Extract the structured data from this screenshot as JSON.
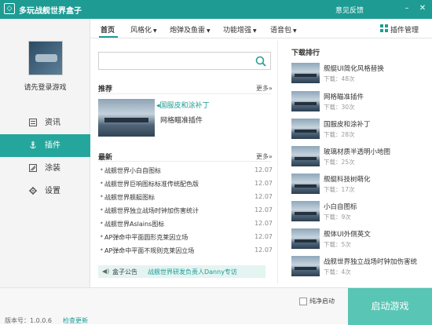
{
  "app": {
    "title": "多玩战舰世界盒子",
    "feedback": "意见反馈",
    "logo": "◇"
  },
  "window_controls": {
    "minimize": "–",
    "close": "✕"
  },
  "sidebar": {
    "login": "请先登录游戏",
    "items": [
      {
        "label": "资讯",
        "icon": "news-icon"
      },
      {
        "label": "插件",
        "icon": "anchor-icon"
      },
      {
        "label": "涂装",
        "icon": "paint-icon"
      },
      {
        "label": "设置",
        "icon": "gear-icon"
      }
    ]
  },
  "tabs": [
    "首页",
    "风格化",
    "炮弹及鱼雷",
    "功能增强",
    "语音包"
  ],
  "plugin_manager": "插件管理",
  "search": {
    "placeholder": ""
  },
  "recommend": {
    "title": "推荐",
    "more": "更多»",
    "items": [
      "◂国服皮和涂补丁",
      "网格瞄准插件"
    ]
  },
  "latest": {
    "title": "最新",
    "more": "更多»",
    "items": [
      {
        "title": "战舰世界小白自图标",
        "date": "12.07"
      },
      {
        "title": "战舰世界巨响图标标准传统配色版",
        "date": "12.07"
      },
      {
        "title": "战舰世界舰艇图标",
        "date": "12.07"
      },
      {
        "title": "战舰世界独立战场时钟加伤害统计",
        "date": "12.07"
      },
      {
        "title": "战舰世界Aslains图标",
        "date": "12.07"
      },
      {
        "title": "AP弹命中平面圆形克莱因立场",
        "date": "12.07"
      },
      {
        "title": "AP弹命中平面不规则克莱因立场",
        "date": "12.07"
      }
    ]
  },
  "notice": {
    "icon": "speaker-icon",
    "label": "盒子公告",
    "text": "战舰世界研发负责人Danny专访"
  },
  "downloads": {
    "title": "下载排行",
    "items": [
      {
        "name": "舰艇UI简化风格替换",
        "count": "下载：48次"
      },
      {
        "name": "网格瞄准插件",
        "count": "下载：30次"
      },
      {
        "name": "国服皮和涂补丁",
        "count": "下载：28次"
      },
      {
        "name": "玻璃材质半透明小地图",
        "count": "下载：25次"
      },
      {
        "name": "舰艇科技树萌化",
        "count": "下载：17次"
      },
      {
        "name": "小白自图标",
        "count": "下载：9次"
      },
      {
        "name": "舰体UI外侧英文",
        "count": "下载：5次"
      },
      {
        "name": "战舰世界独立战场时钟加伤害统",
        "count": "下载：4次"
      }
    ]
  },
  "footer": {
    "version": "版本号：1.0.0.6",
    "check_update": "检查更新",
    "pure_start": "纯净启动",
    "start_game": "启动游戏"
  },
  "colors": {
    "accent": "#1e9c94",
    "start_button": "#59c5b5"
  }
}
